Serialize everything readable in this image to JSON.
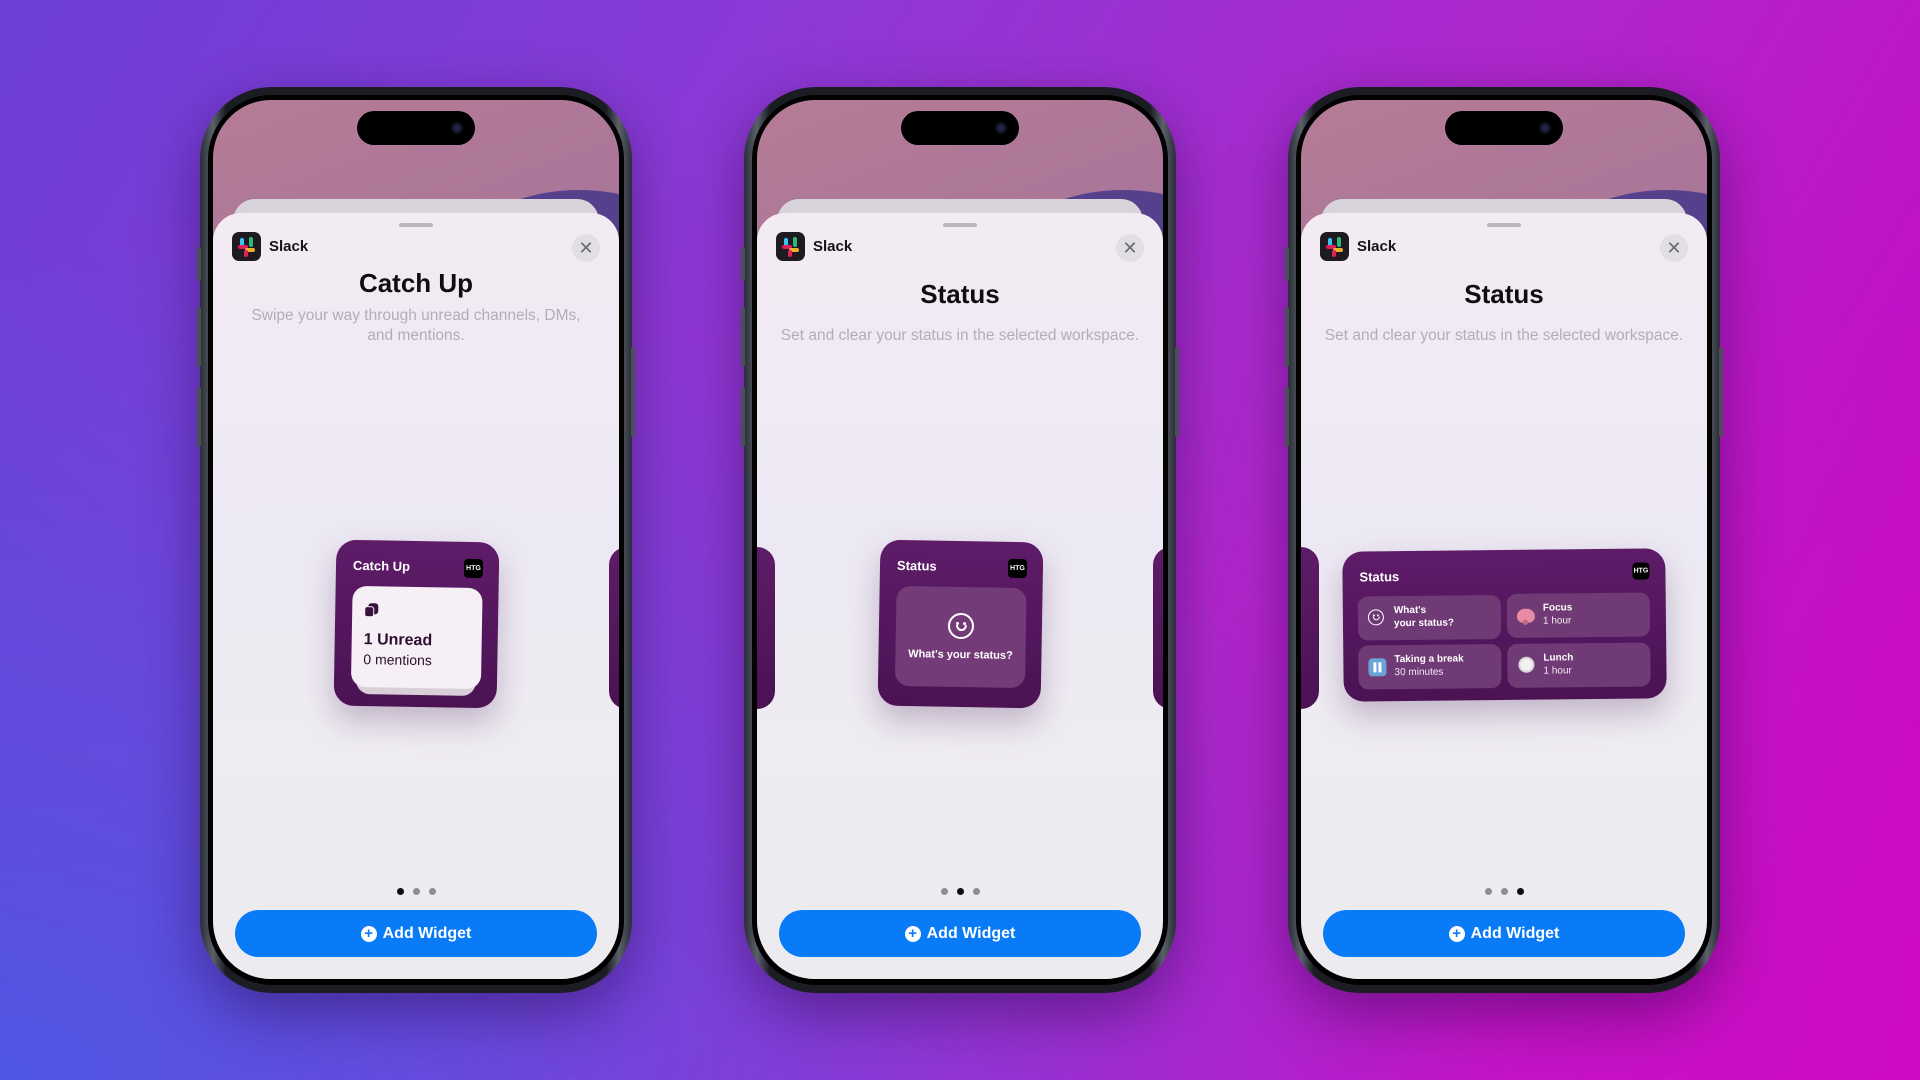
{
  "app": {
    "name": "Slack",
    "close_glyph": "✕"
  },
  "add_widget_label": "Add Widget",
  "badge_label": "HTG",
  "screens": [
    {
      "title": "Catch Up",
      "description": "Swipe your way through unread channels, DMs, and mentions.",
      "widget": {
        "kind": "catch-up",
        "title": "Catch Up",
        "main": "1 Unread",
        "sub": "0 mentions"
      },
      "page_index": 1,
      "page_count": 3
    },
    {
      "title": "Status",
      "description": "Set and clear your status in the selected workspace.",
      "widget": {
        "kind": "status-small",
        "title": "Status",
        "prompt": "What's your status?"
      },
      "page_index": 2,
      "page_count": 3
    },
    {
      "title": "Status",
      "description": "Set and clear your status in the selected workspace.",
      "widget": {
        "kind": "status-medium",
        "title": "Status",
        "tiles": [
          {
            "icon": "smiley-icon",
            "line1": "What's",
            "line2": "your status?"
          },
          {
            "icon": "brain-icon",
            "line1": "Focus",
            "line2": "1 hour"
          },
          {
            "icon": "pause-icon",
            "line1": "Taking a break",
            "line2": "30 minutes"
          },
          {
            "icon": "plate-icon",
            "line1": "Lunch",
            "line2": "1 hour"
          }
        ]
      },
      "page_index": 3,
      "page_count": 3
    }
  ],
  "colors": {
    "button": "#0a7bf7",
    "widget": "#5e1c68",
    "slack_blue": "#36c5f0",
    "slack_green": "#2eb67d",
    "slack_red": "#e01e5a",
    "slack_yellow": "#ecb22e"
  }
}
